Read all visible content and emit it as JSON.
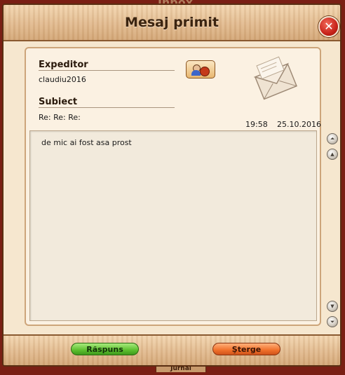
{
  "background": {
    "title": "Inbox",
    "bottom_tab": "Jurnal"
  },
  "window": {
    "title": "Mesaj primit",
    "close_label": "✕"
  },
  "message": {
    "sender_label": "Expeditor",
    "sender": "claudiu2016",
    "subject_label": "Subiect",
    "subject": "Re: Re: Re:",
    "time": "19:58",
    "date": "25.10.2016",
    "body": "de mic ai fost asa prost"
  },
  "scroll": {
    "top": "⏶",
    "up": "▲",
    "down": "▼",
    "bottom": "⏷"
  },
  "actions": {
    "reply_label": "Răspuns",
    "delete_label": "Şterge"
  },
  "colors": {
    "reply_button": "#5cbf2e",
    "delete_button": "#f0702a",
    "close_button": "#c8231a"
  }
}
